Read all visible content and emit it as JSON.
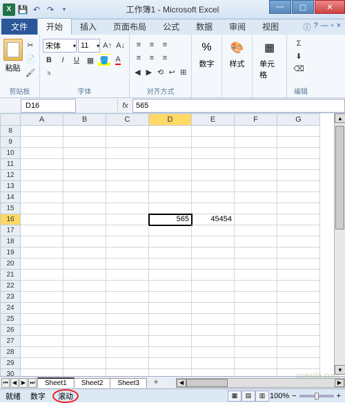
{
  "app": {
    "title": "工作簿1 - Microsoft Excel"
  },
  "tabs": {
    "file": "文件",
    "items": [
      "开始",
      "插入",
      "页面布局",
      "公式",
      "数据",
      "审阅",
      "视图"
    ],
    "active_index": 0
  },
  "ribbon": {
    "clipboard": {
      "label": "剪贴板",
      "paste": "粘贴"
    },
    "font": {
      "label": "字体",
      "name": "宋体",
      "size": "11",
      "bold": "B",
      "italic": "I",
      "underline": "U"
    },
    "alignment": {
      "label": "对齐方式"
    },
    "number": {
      "label": "数字",
      "pct": "%"
    },
    "styles": {
      "label": "样式"
    },
    "cells": {
      "label": "单元格"
    },
    "editing": {
      "label": "编辑",
      "sigma": "Σ"
    }
  },
  "namebox": "D16",
  "fx_label": "fx",
  "formula_value": "565",
  "columns": [
    "A",
    "B",
    "C",
    "D",
    "E",
    "F",
    "G"
  ],
  "rows": [
    8,
    9,
    10,
    11,
    12,
    13,
    14,
    15,
    16,
    17,
    18,
    19,
    20,
    21,
    22,
    23,
    24,
    25,
    26,
    27,
    28,
    29,
    30
  ],
  "selected_col": "D",
  "selected_row": 16,
  "cells": {
    "D16": "565",
    "E16": "45454"
  },
  "sheets": [
    "Sheet1",
    "Sheet2",
    "Sheet3"
  ],
  "active_sheet": 0,
  "status": {
    "ready": "就绪",
    "num": "数字",
    "scroll": "滚动"
  },
  "zoom": {
    "label": "100%",
    "minus": "−",
    "plus": "+"
  },
  "watermark": "xuexila.com"
}
